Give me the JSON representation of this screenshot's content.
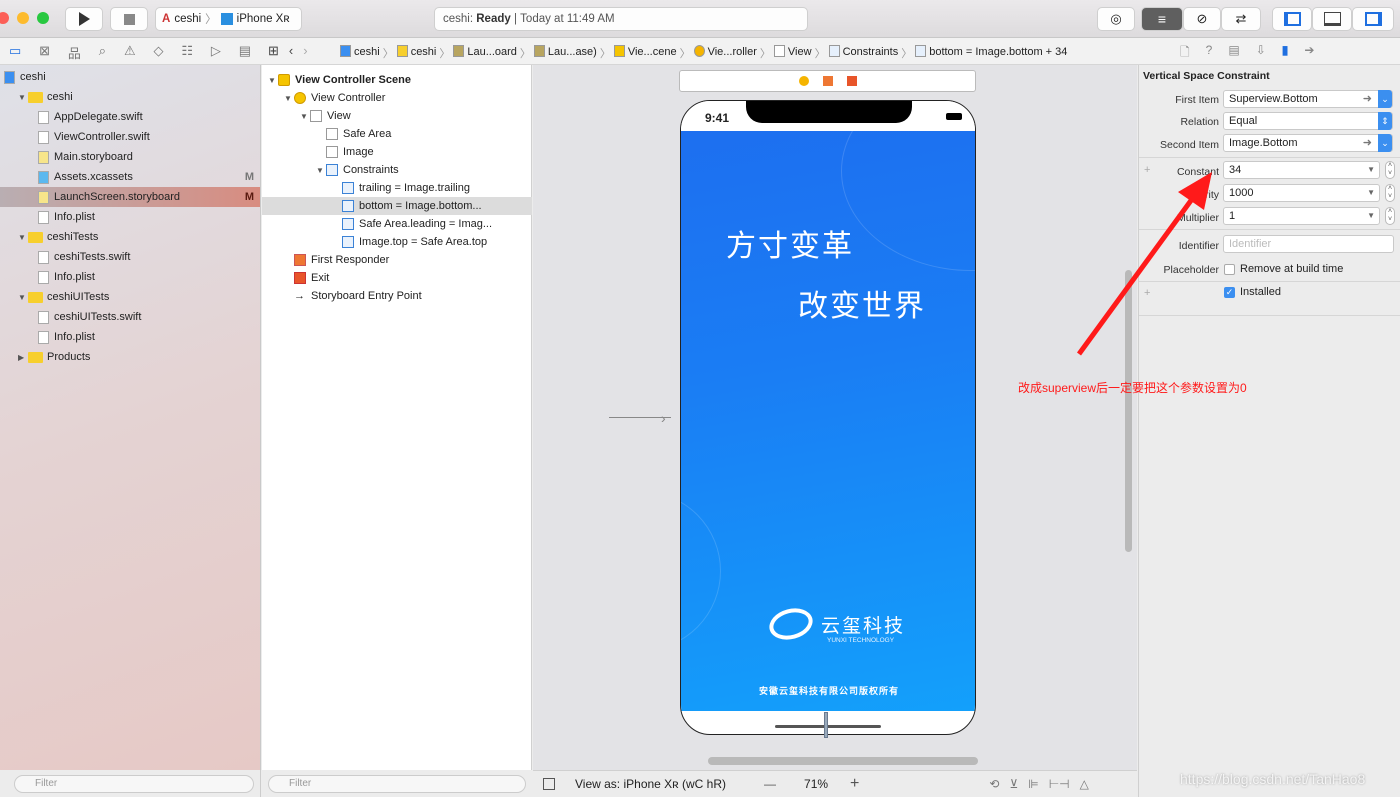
{
  "toolbar": {
    "scheme": "ceshi",
    "device": "iPhone Xʀ",
    "status_project": "ceshi:",
    "status_state": "Ready",
    "status_time": "Today at 11:49 AM"
  },
  "jumpbar": [
    "ceshi",
    "ceshi",
    "Lau...oard",
    "Lau...ase)",
    "Vie...cene",
    "Vie...roller",
    "View",
    "Constraints",
    "bottom = Image.bottom + 34"
  ],
  "navigator": {
    "items": [
      {
        "label": "ceshi",
        "type": "project",
        "level": 0
      },
      {
        "label": "ceshi",
        "type": "folder",
        "level": 1,
        "expanded": true
      },
      {
        "label": "AppDelegate.swift",
        "type": "swift",
        "level": 2
      },
      {
        "label": "ViewController.swift",
        "type": "swift",
        "level": 2
      },
      {
        "label": "Main.storyboard",
        "type": "storyboard",
        "level": 2
      },
      {
        "label": "Assets.xcassets",
        "type": "assets",
        "level": 2,
        "badge": "M"
      },
      {
        "label": "LaunchScreen.storyboard",
        "type": "storyboard",
        "level": 2,
        "badge": "M",
        "selected": true
      },
      {
        "label": "Info.plist",
        "type": "plist",
        "level": 2
      },
      {
        "label": "ceshiTests",
        "type": "folder",
        "level": 1,
        "expanded": true
      },
      {
        "label": "ceshiTests.swift",
        "type": "swift",
        "level": 2
      },
      {
        "label": "Info.plist",
        "type": "plist",
        "level": 2
      },
      {
        "label": "ceshiUITests",
        "type": "folder",
        "level": 1,
        "expanded": true
      },
      {
        "label": "ceshiUITests.swift",
        "type": "swift",
        "level": 2
      },
      {
        "label": "Info.plist",
        "type": "plist",
        "level": 2
      },
      {
        "label": "Products",
        "type": "folder",
        "level": 1,
        "expanded": false
      }
    ],
    "filter_placeholder": "Filter"
  },
  "outline": {
    "items": [
      {
        "label": "View Controller Scene",
        "level": 0,
        "bold": true
      },
      {
        "label": "View Controller",
        "level": 1
      },
      {
        "label": "View",
        "level": 2
      },
      {
        "label": "Safe Area",
        "level": 3
      },
      {
        "label": "Image",
        "level": 3
      },
      {
        "label": "Constraints",
        "level": 3
      },
      {
        "label": "trailing = Image.trailing",
        "level": 4
      },
      {
        "label": "bottom = Image.bottom...",
        "level": 4,
        "selected": true
      },
      {
        "label": "Safe Area.leading = Imag...",
        "level": 4
      },
      {
        "label": "Image.top = Safe Area.top",
        "level": 4
      },
      {
        "label": "First Responder",
        "level": 1
      },
      {
        "label": "Exit",
        "level": 1
      },
      {
        "label": "Storyboard Entry Point",
        "level": 1
      }
    ],
    "filter_placeholder": "Filter"
  },
  "device": {
    "time": "9:41",
    "headline1": "方寸变革",
    "headline2": "改变世界",
    "logo_cn": "云玺科技",
    "logo_en": "YUNXI TECHNOLOGY",
    "copyright": "安徽云玺科技有限公司版权所有"
  },
  "canvas_bar": {
    "view_as": "View as: iPhone Xʀ (wC hR)",
    "zoom": "71%",
    "zoom_out": "—",
    "zoom_in": "+"
  },
  "inspector": {
    "title": "Vertical Space Constraint",
    "first_item_label": "First Item",
    "first_item": "Superview.Bottom",
    "relation_label": "Relation",
    "relation": "Equal",
    "second_item_label": "Second Item",
    "second_item": "Image.Bottom",
    "constant_label": "Constant",
    "constant": "34",
    "priority_label": "Priority",
    "priority": "1000",
    "multiplier_label": "Multiplier",
    "multiplier": "1",
    "identifier_label": "Identifier",
    "identifier_placeholder": "Identifier",
    "placeholder_label": "Placeholder",
    "placeholder_checkbox": "Remove at build time",
    "installed": "Installed"
  },
  "annotation": {
    "text": "改成superview后一定要把这个参数设置为0",
    "color": "#ff1a1a"
  },
  "watermark": "https://blog.csdn.net/TanHao8"
}
